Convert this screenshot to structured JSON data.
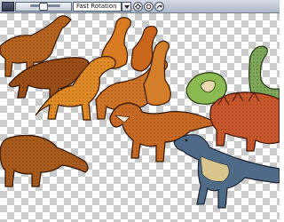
{
  "toolbar": {
    "rotation_mode": {
      "selected": "Fast Rotation"
    },
    "icons": [
      "slider-icon",
      "chevron-down-icon",
      "gear-icon",
      "circle-icon",
      "arrow-icon"
    ]
  },
  "canvas": {
    "background": "transparency-checkerboard",
    "sprites": [
      "brown-sauropod-sprite",
      "brown-quadruped-sprite",
      "orange-long-neck-sprite",
      "orange-hadrosaur-sprite",
      "orange-sauropod-sprite",
      "brown-sauropod-sprite-2",
      "orange-theropod-sprite",
      "green-ceratopsian-sprite",
      "green-long-neck-sprite",
      "red-ankylosaur-sprite",
      "brown-sauropod-sprite-3",
      "blue-raptor-sprite"
    ]
  }
}
